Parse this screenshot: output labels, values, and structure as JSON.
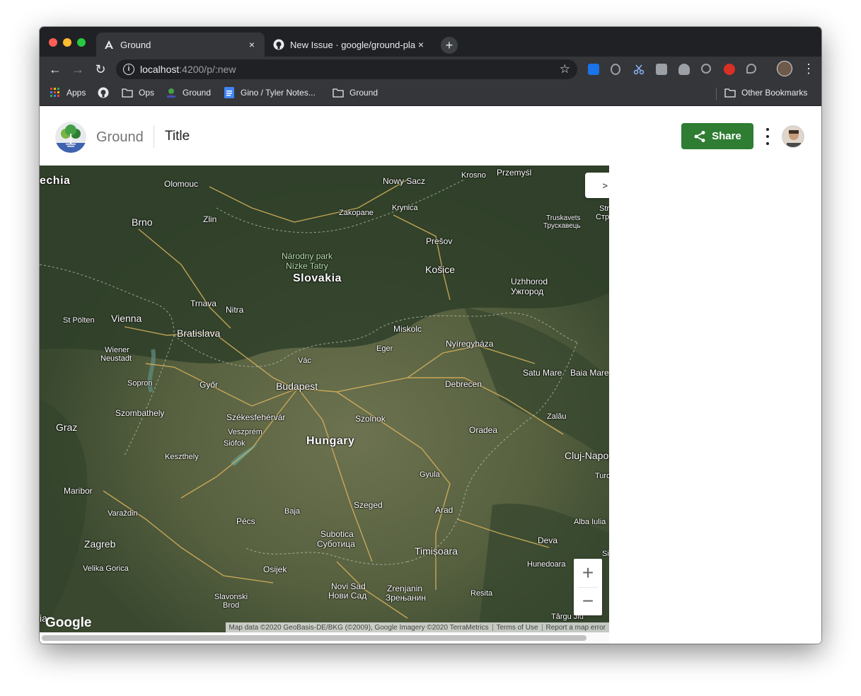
{
  "browser": {
    "tabs": [
      {
        "title": "Ground",
        "close": "×"
      },
      {
        "title": "New Issue · google/ground-pla",
        "close": "×"
      }
    ],
    "new_tab": "+",
    "nav": {
      "back": "←",
      "forward": "→",
      "reload": "↻"
    },
    "url": {
      "host": "localhost",
      "path": ":4200/p/:new"
    },
    "star": "☆",
    "menu": "⋮",
    "bookmarks": [
      {
        "label": "Apps"
      },
      {
        "label": ""
      },
      {
        "label": "Ops"
      },
      {
        "label": "Ground"
      },
      {
        "label": "Gino / Tyler Notes..."
      },
      {
        "label": "Ground"
      }
    ],
    "other_bookmarks": "Other Bookmarks"
  },
  "app": {
    "brand": "Ground",
    "title": "Title",
    "share_label": "Share"
  },
  "map": {
    "panel_toggle": ">",
    "zoom_in": "+",
    "zoom_out": "−",
    "google_logo": "Google",
    "attribution": "Map data ©2020 GeoBasis-DE/BKG (©2009), Google Imagery ©2020 TerraMetrics",
    "terms": "Terms of Use",
    "report": "Report a map error",
    "labels": {
      "czechia": "echia",
      "olomouc": "Olomouc",
      "nowy_sacz": "Nowy Sacz",
      "krosno": "Krosno",
      "przemysl": "Przemyśl",
      "brno": "Brno",
      "zlin": "Zlin",
      "zakopane": "Zakopane",
      "krynica": "Krynica",
      "truskavets": "Truskavets",
      "truskavets_cyr": "Трускавець",
      "str": "Str",
      "str2": "Стр",
      "presov": "Prešov",
      "narodny_park": "Národny park",
      "nizke_tatry": "Nízke Tatry",
      "slovakia": "Slovakia",
      "kosice": "Košice",
      "uzhhorod": "Uzhhorod",
      "uzhhorod_cyr": "Ужгород",
      "trnava": "Trnava",
      "nitra": "Nitra",
      "st_polten": "St Pölten",
      "vienna": "Vienna",
      "bratislava": "Bratislava",
      "miskolc": "Miskolc",
      "nyiregyhaza": "Nyíregyháza",
      "eger": "Eger",
      "wiener": "Wiener",
      "neustadt": "Neustadt",
      "vac": "Vác",
      "satu_mare": "Satu Mare",
      "baia_mare": "Baia Mare",
      "sopron": "Sopron",
      "gyor": "Győr",
      "budapest": "Budapest",
      "debrecen": "Debrecen",
      "szombathely": "Szombathely",
      "szekesfehervar": "Székesfehérvár",
      "szolnok": "Szolnok",
      "zalau": "Zalău",
      "graz": "Graz",
      "veszprem": "Veszprém",
      "siofok": "Siófok",
      "hungary": "Hungary",
      "oradea": "Oradea",
      "cluj": "Cluj-Napo",
      "keszthely": "Keszthely",
      "gyula": "Gyula",
      "turd": "Turd",
      "maribor": "Maribor",
      "baja": "Baja",
      "szeged": "Szeged",
      "arad": "Arad",
      "varazdin": "Varaždin",
      "pecs": "Pécs",
      "alba_iulia": "Alba Iulia",
      "zagreb": "Zagreb",
      "subotica": "Subotica",
      "subotica_cyr": "Суботица",
      "timisoara": "Timișoara",
      "deva": "Deva",
      "velika_gorica": "Velika Gorica",
      "osijek": "Osijek",
      "hunedoara": "Hunedoara",
      "novi_sad": "Novi Sad",
      "novi_sad_cyr": "Нови Сад",
      "zrenjanin": "Zrenjanin",
      "zrenjanin_cyr": "Зрењанин",
      "resita": "Resita",
      "slavonski": "Slavonski",
      "brod": "Brod",
      "targu_jiu": "Târgu Jiu",
      "si": "Si",
      "ia": "ia"
    }
  },
  "colors": {
    "share_green": "#2e7d32",
    "chrome_dark": "#202124",
    "chrome_toolbar": "#35363a"
  }
}
